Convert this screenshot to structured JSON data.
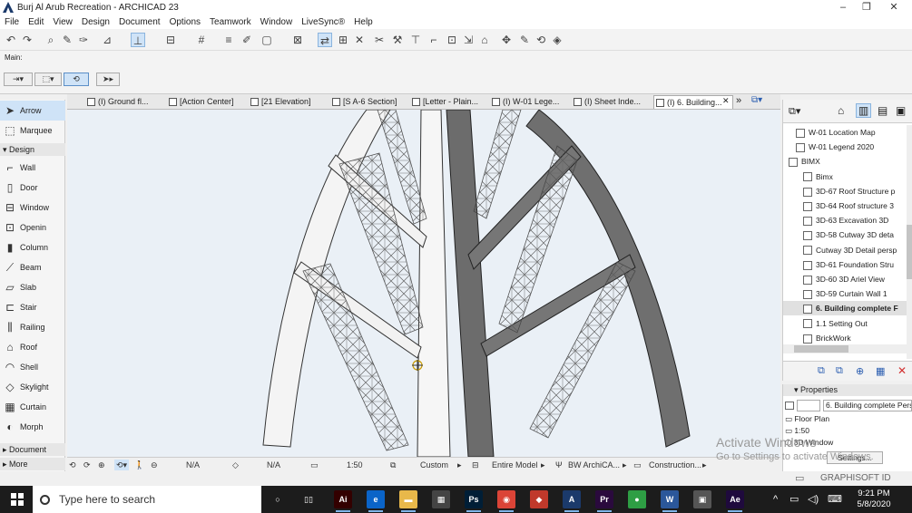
{
  "window": {
    "title": "Burj Al Arub Recreation - ARCHICAD 23",
    "minimize": "–",
    "maximize": "❐",
    "close": "✕"
  },
  "menu": [
    "File",
    "Edit",
    "View",
    "Design",
    "Document",
    "Options",
    "Teamwork",
    "Window",
    "LiveSync®",
    "Help"
  ],
  "infobox": {
    "label": "Main:"
  },
  "tabs": [
    {
      "label": "(I) Ground fl..."
    },
    {
      "label": "[Action Center]"
    },
    {
      "label": "[21 Elevation]"
    },
    {
      "label": "[S A-6 Section]"
    },
    {
      "label": "[Letter - Plain..."
    },
    {
      "label": "(I) W-01 Lege..."
    },
    {
      "label": "(I) Sheet Inde..."
    },
    {
      "label": "(I) 6. Building..."
    }
  ],
  "tab_close": "✕",
  "tab_more": "»",
  "toolbox": {
    "arrow": "Arrow",
    "marquee": "Marquee",
    "design_group": "Design",
    "tools": [
      "Wall",
      "Door",
      "Window",
      "Openin",
      "Column",
      "Beam",
      "Slab",
      "Stair",
      "Railing",
      "Roof",
      "Shell",
      "Skylight",
      "Curtain",
      "Morph"
    ],
    "document_group": "Document",
    "more_group": "More"
  },
  "status": {
    "angle": "N/A",
    "scale_val": "N/A",
    "scale": "1:50",
    "layer_combo": "Custom",
    "model_view": "Entire Model",
    "pen_set": "BW ArchiCA...",
    "dimension": "Construction..."
  },
  "navigator": {
    "items": [
      {
        "label": "W-01 Location Map",
        "indent": 1
      },
      {
        "label": "W-01 Legend 2020",
        "indent": 1
      },
      {
        "label": "BIMX",
        "indent": 0
      },
      {
        "label": "Bimx",
        "indent": 2
      },
      {
        "label": "3D-67 Roof Structure p",
        "indent": 2
      },
      {
        "label": "3D-64 Roof structure 3",
        "indent": 2
      },
      {
        "label": "3D-63 Excavation 3D",
        "indent": 2
      },
      {
        "label": "3D-58 Cutway 3D deta",
        "indent": 2
      },
      {
        "label": "Cutway 3D Detail persp",
        "indent": 2
      },
      {
        "label": "3D-61 Foundation Stru",
        "indent": 2
      },
      {
        "label": "3D-60 3D Ariel View",
        "indent": 2
      },
      {
        "label": "3D-59 Curtain Wall 1",
        "indent": 2
      },
      {
        "label": "6. Building complete F",
        "indent": 2,
        "selected": true
      },
      {
        "label": "1.1 Setting Out",
        "indent": 2
      },
      {
        "label": "BrickWork",
        "indent": 2
      }
    ]
  },
  "properties": {
    "header": "Properties",
    "name_value": "6. Building complete Pers",
    "row1": "Floor Plan",
    "row2": "1:50",
    "row3": "3D Window",
    "settings": "Settings..."
  },
  "graphisoft": "GRAPHISOFT ID",
  "watermark": {
    "line1": "Activate Windows",
    "line2": "Go to Settings to activate Windows."
  },
  "taskbar": {
    "search_placeholder": "Type here to search",
    "apps": [
      {
        "name": "cortana",
        "glyph": "○",
        "color": "#1c1c1c"
      },
      {
        "name": "task-view",
        "glyph": "▯▯",
        "color": "#1c1c1c"
      },
      {
        "name": "illustrator",
        "glyph": "Ai",
        "color": "#330000"
      },
      {
        "name": "edge",
        "glyph": "e",
        "color": "#0a64c8"
      },
      {
        "name": "file-explorer",
        "glyph": "▬",
        "color": "#e8b84a"
      },
      {
        "name": "calculator",
        "glyph": "▦",
        "color": "#444444"
      },
      {
        "name": "photoshop",
        "glyph": "Ps",
        "color": "#001e36"
      },
      {
        "name": "chrome",
        "glyph": "◉",
        "color": "#db4437"
      },
      {
        "name": "app-red",
        "glyph": "◆",
        "color": "#c0392b"
      },
      {
        "name": "archicad",
        "glyph": "A",
        "color": "#1b3a6b"
      },
      {
        "name": "premiere",
        "glyph": "Pr",
        "color": "#2a0a3d"
      },
      {
        "name": "app-green",
        "glyph": "●",
        "color": "#2e9e44"
      },
      {
        "name": "word",
        "glyph": "W",
        "color": "#2b579a"
      },
      {
        "name": "app-image",
        "glyph": "▣",
        "color": "#555555"
      },
      {
        "name": "after-effects",
        "glyph": "Ae",
        "color": "#1f0a3d"
      }
    ],
    "tray_arrow": "^",
    "time": "9:21 PM",
    "date": "5/8/2020"
  },
  "colors": {
    "accent": "#cfe3f7",
    "taskbar": "#1c1c1c",
    "viewport": "#eaf0f6"
  }
}
